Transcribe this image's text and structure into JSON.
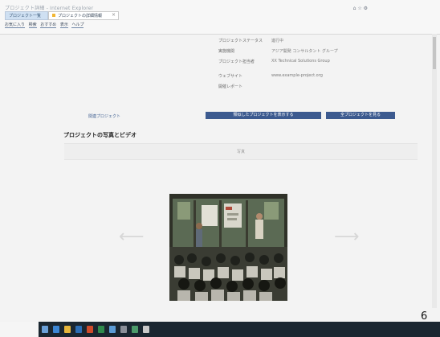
{
  "browser": {
    "title": "プロジェクト詳細 - Internet Explorer",
    "tabs": [
      {
        "label": "プロジェクト一覧"
      },
      {
        "label": "プロジェクトの詳細情報"
      }
    ],
    "window_controls": "⌂ ☆ ⚙",
    "nav_links": [
      "お気に入り",
      "検索",
      "おすすめ",
      "表示",
      "ヘルプ"
    ]
  },
  "details": {
    "rows": [
      {
        "label": "プロジェクトステータス",
        "value": "進行中"
      },
      {
        "label": "実施機関",
        "value": "アジア開発 コンサルタント グループ"
      },
      {
        "label": "プロジェクト担当者",
        "value": "XX Technical Solutions Group"
      },
      {
        "label": "ウェブサイト",
        "value": "www.example-project.org"
      },
      {
        "label": "開催レポート",
        "value": ""
      }
    ]
  },
  "actions": {
    "related_projects": "関連プロジェクト",
    "primary_button": "類似したプロジェクトを表示する",
    "secondary_button": "全プロジェクトを見る"
  },
  "section": {
    "title": "プロジェクトの写真とビデオ",
    "bar_label": "写真"
  },
  "carousel": {
    "prev_label": "⟵",
    "next_label": "⟶"
  },
  "page_number": "6",
  "colors": {
    "button_bg": "#3c5a8f",
    "link": "#3f5f91",
    "taskbar": "#1a2630"
  }
}
